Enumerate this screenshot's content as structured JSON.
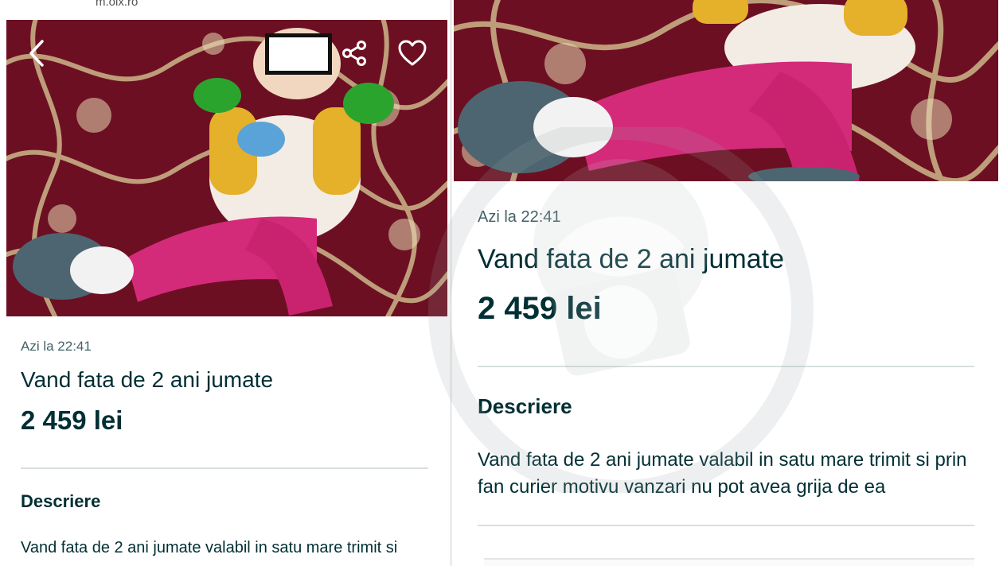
{
  "browser": {
    "url": "m.olx.ro"
  },
  "listing": {
    "posted": "Azi la 22:41",
    "title": "Vand fata de 2 ani jumate",
    "price": "2 459 lei",
    "description_heading": "Descriere",
    "description": "Vand fata de 2 ani jumate valabil in satu mare trimit si prin fan curier motivu vanzari nu pot avea grija de ea",
    "description_left_visible": "Vand fata de 2 ani jumate valabil in satu mare trimit si"
  },
  "photo_toolbar": {
    "back_icon": "chevron-left-icon",
    "share_icon": "share-icon",
    "favorite_icon": "heart-icon"
  },
  "colors": {
    "text": "#002f34",
    "muted": "#406367",
    "fabric": "#7a1426",
    "pattern": "#d9c7a0",
    "leggings": "#d42a7a",
    "censor_border": "#111111"
  }
}
